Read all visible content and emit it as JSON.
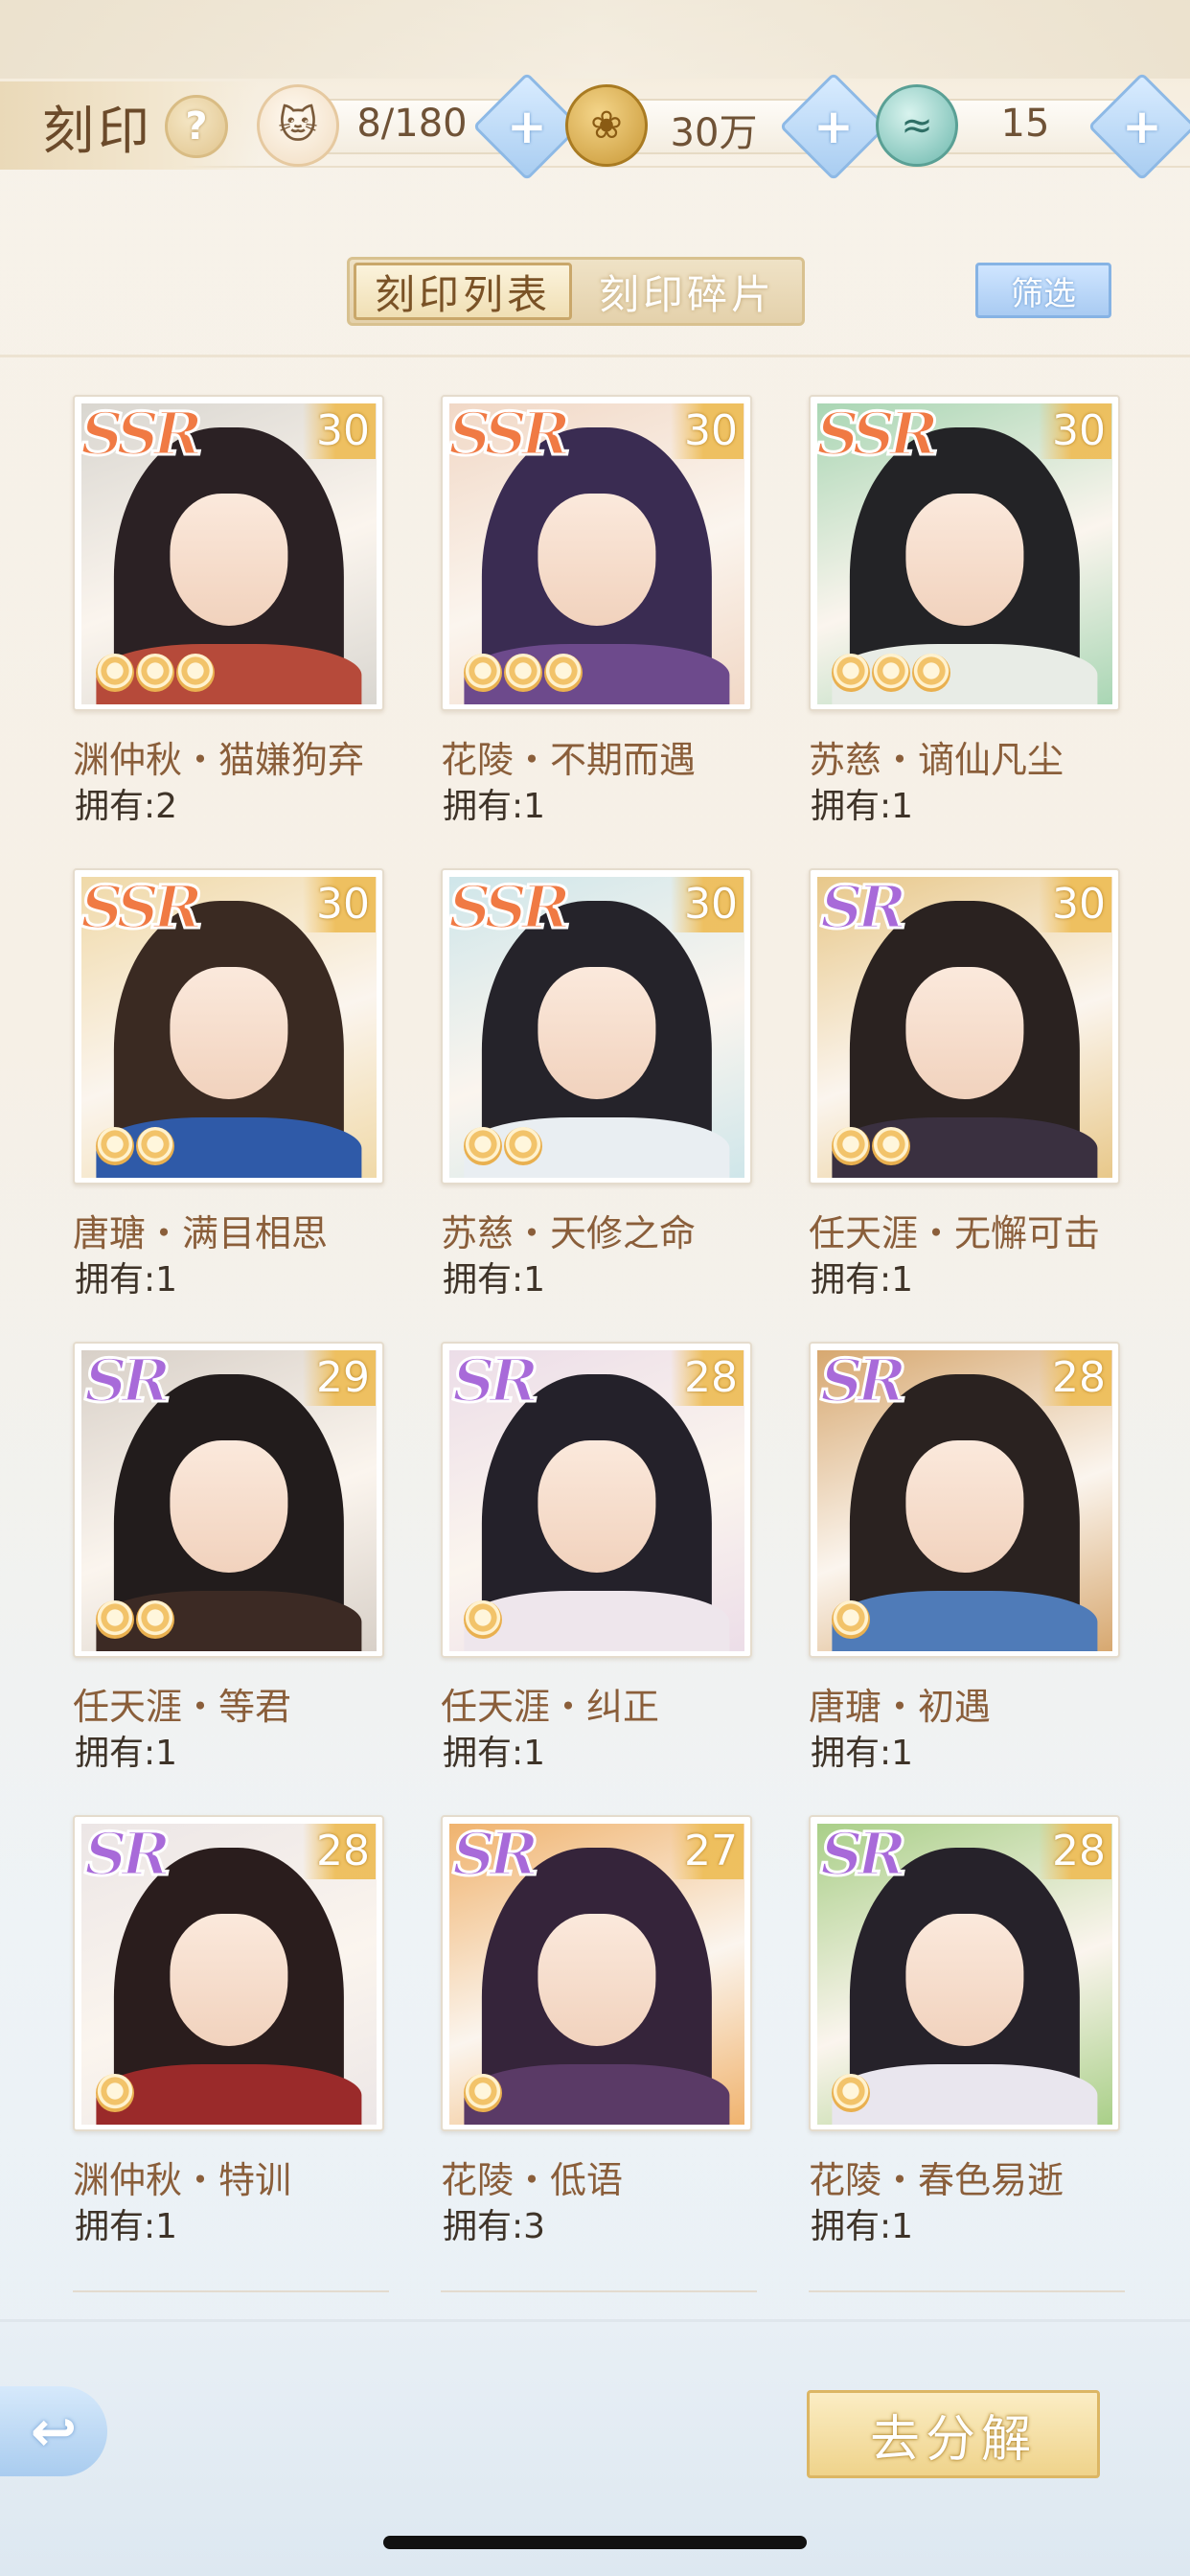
{
  "header": {
    "title": "刻印",
    "help_icon": "?",
    "resources": [
      {
        "icon": "cat-icon",
        "value": "8/180"
      },
      {
        "icon": "coin-icon",
        "value": "30万"
      },
      {
        "icon": "fish-icon",
        "value": "15"
      }
    ],
    "plus_label": "+"
  },
  "tabs": [
    {
      "label": "刻印列表",
      "active": true
    },
    {
      "label": "刻印碎片",
      "active": false
    }
  ],
  "filter_label": "筛选",
  "cards": [
    {
      "rarity": "SSR",
      "level": "30",
      "stars": 3,
      "name": "渊仲秋・猫嫌狗弃",
      "owned": "拥有:2",
      "bg": "#d9d6d0",
      "hair": "#2b2124",
      "body": "#b64a3a"
    },
    {
      "rarity": "SSR",
      "level": "30",
      "stars": 3,
      "name": "花陵・不期而遇",
      "owned": "拥有:1",
      "bg": "#f1d8c6",
      "hair": "#3a2c52",
      "body": "#6d4a8c"
    },
    {
      "rarity": "SSR",
      "level": "30",
      "stars": 3,
      "name": "苏慈・谪仙凡尘",
      "owned": "拥有:1",
      "bg": "#a9d6b4",
      "hair": "#232326",
      "body": "#e8ece6"
    },
    {
      "rarity": "SSR",
      "level": "30",
      "stars": 2,
      "name": "唐瑭・满目相思",
      "owned": "拥有:1",
      "bg": "#f0d9a8",
      "hair": "#3a2a22",
      "body": "#2f5aa8"
    },
    {
      "rarity": "SSR",
      "level": "30",
      "stars": 2,
      "name": "苏慈・天修之命",
      "owned": "拥有:1",
      "bg": "#cfe6ea",
      "hair": "#25232a",
      "body": "#e9eef2"
    },
    {
      "rarity": "SR",
      "level": "30",
      "stars": 2,
      "name": "任天涯・无懈可击",
      "owned": "拥有:1",
      "bg": "#e8c88a",
      "hair": "#2a2220",
      "body": "#3a3040"
    },
    {
      "rarity": "SR",
      "level": "29",
      "stars": 2,
      "name": "任天涯・等君",
      "owned": "拥有:1",
      "bg": "#d8d0c8",
      "hair": "#221c1c",
      "body": "#3c2a24"
    },
    {
      "rarity": "SR",
      "level": "28",
      "stars": 1,
      "name": "任天涯・纠正",
      "owned": "拥有:1",
      "bg": "#ecdde8",
      "hair": "#24212a",
      "body": "#eee6ec"
    },
    {
      "rarity": "SR",
      "level": "28",
      "stars": 1,
      "name": "唐瑭・初遇",
      "owned": "拥有:1",
      "bg": "#d7a870",
      "hair": "#2a2220",
      "body": "#4f7bb8"
    },
    {
      "rarity": "SR",
      "level": "28",
      "stars": 1,
      "name": "渊仲秋・特训",
      "owned": "拥有:1",
      "bg": "#ece6e6",
      "hair": "#2a1d1d",
      "body": "#9a2a2a"
    },
    {
      "rarity": "SR",
      "level": "27",
      "stars": 1,
      "name": "花陵・低语",
      "owned": "拥有:3",
      "bg": "#f0b36e",
      "hair": "#35243a",
      "body": "#5a3a66"
    },
    {
      "rarity": "SR",
      "level": "28",
      "stars": 1,
      "name": "花陵・春色易逝",
      "owned": "拥有:1",
      "bg": "#a9cf88",
      "hair": "#26222a",
      "body": "#e9e6ee"
    }
  ],
  "footer": {
    "back_icon": "↩",
    "decompose_label": "去分解"
  }
}
